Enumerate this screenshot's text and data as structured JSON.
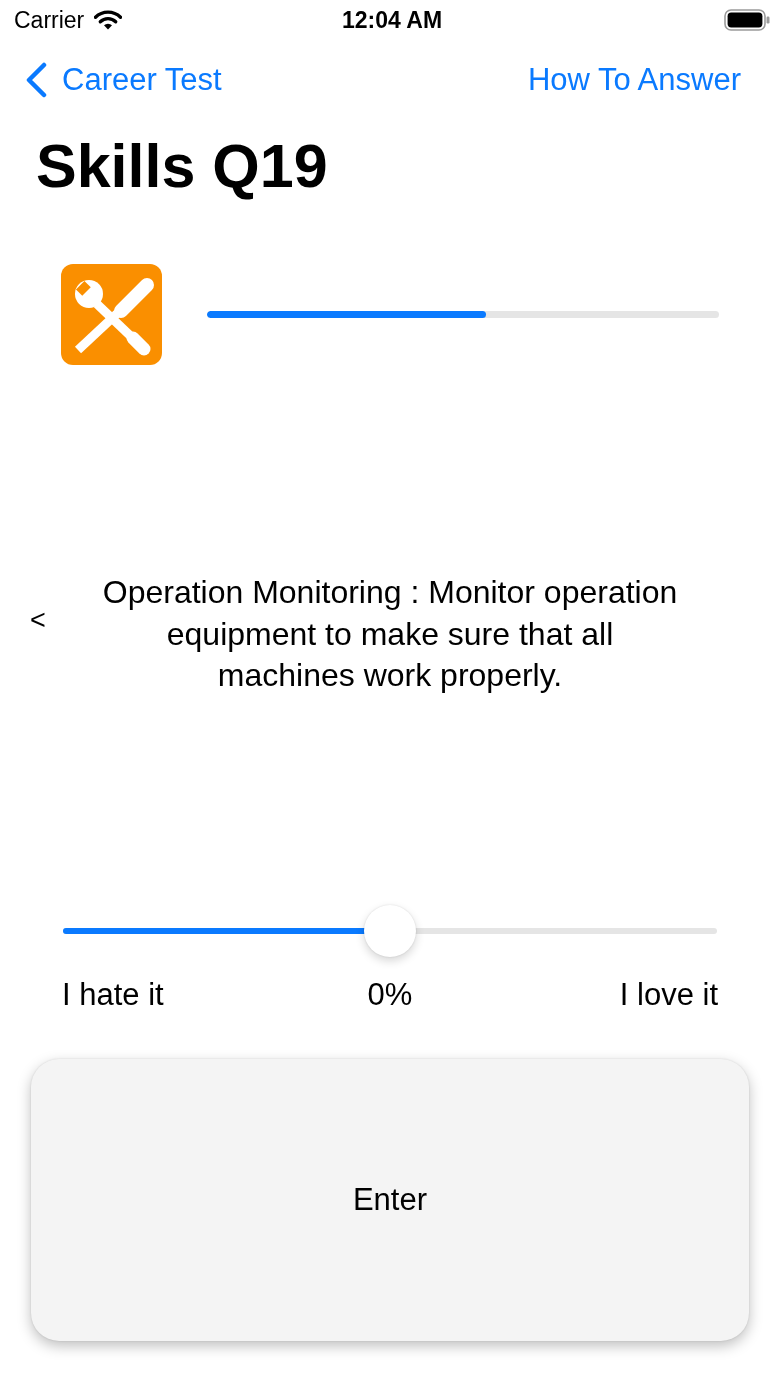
{
  "status_bar": {
    "carrier": "Carrier",
    "time": "12:04 AM"
  },
  "nav_bar": {
    "back": "Career Test",
    "action": "How To Answer"
  },
  "title": "Skills Q19",
  "progress": {
    "level": 0.545
  },
  "question": {
    "previous": "<",
    "text": "Operation Monitoring : Monitor operation equipment to make sure that all machines work properly."
  },
  "rating": {
    "level": 0.5,
    "min_label": "I hate it",
    "reading": "0%",
    "max_label": "I love it"
  },
  "enter_button": {
    "label": "Enter"
  }
}
